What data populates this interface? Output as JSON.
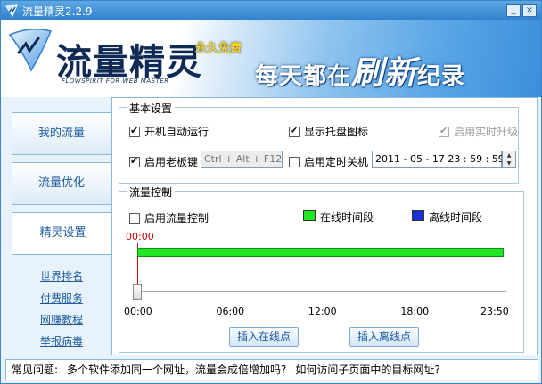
{
  "window": {
    "title": "流量精灵2.2.9",
    "minimize_glyph": "_",
    "close_glyph": "×"
  },
  "banner": {
    "brand": "流量精灵",
    "brand_sub": "FLOWSPIRIT FOR WEB MASTER",
    "free_tag": "永久免费",
    "slogan_a": "每天都在",
    "slogan_b": "刷新",
    "slogan_c": "纪录"
  },
  "sidebar": {
    "tabs": [
      {
        "label": "我的流量"
      },
      {
        "label": "流量优化"
      },
      {
        "label": "精灵设置"
      }
    ],
    "active_tab": "精灵设置",
    "links": [
      {
        "label": "世界排名"
      },
      {
        "label": "付费服务"
      },
      {
        "label": "网赚教程"
      },
      {
        "label": "举报病毒"
      }
    ]
  },
  "basic": {
    "legend": "基本设置",
    "autostart": {
      "label": "开机自动运行",
      "checked": true
    },
    "tray_icon": {
      "label": "显示托盘图标",
      "checked": true
    },
    "live_upgrade": {
      "label": "启用实时升级",
      "checked": true,
      "disabled": true
    },
    "boss_key": {
      "label": "启用老板键",
      "checked": true,
      "value": "Ctrl + Alt + F12"
    },
    "timed_shutdown": {
      "label": "启用定时关机",
      "checked": false,
      "value": "2011 - 05 - 17    23 : 59 : 59"
    }
  },
  "flow": {
    "legend": "流量控制",
    "enable": {
      "label": "启用流量控制",
      "checked": false
    },
    "legend_online": "在线时间段",
    "legend_offline": "离线时间段",
    "cursor_time": "00:00",
    "ticks": [
      "00:00",
      "06:00",
      "12:00",
      "18:00",
      "23:50"
    ],
    "online_segment": {
      "start": "00:00",
      "end": "23:50"
    },
    "insert_online": "插入在线点",
    "insert_offline": "插入离线点"
  },
  "colors": {
    "online": "#22e622",
    "offline": "#1432d8",
    "cursor": "#d00000",
    "accent": "#1f5da0"
  },
  "footer": {
    "label": "常见问题:",
    "q1": "多个软件添加同一个网址，流量会成倍增加吗?",
    "q2": "如何访问子页面中的目标网址?"
  }
}
